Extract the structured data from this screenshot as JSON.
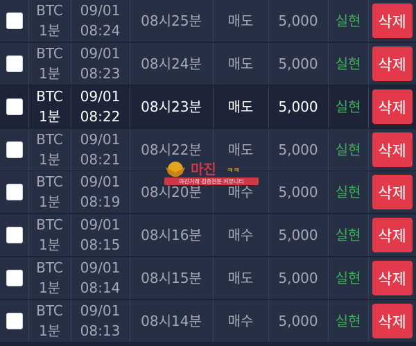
{
  "rows": [
    {
      "symbol": "BTC",
      "interval": "1분",
      "date": "09/01",
      "time": "08:24",
      "slot": "08시25분",
      "side": "매도",
      "amount": "5,000",
      "status": "실현",
      "delete_label": "삭제"
    },
    {
      "symbol": "BTC",
      "interval": "1분",
      "date": "09/01",
      "time": "08:23",
      "slot": "08시24분",
      "side": "매도",
      "amount": "5,000",
      "status": "실현",
      "delete_label": "삭제"
    },
    {
      "symbol": "BTC",
      "interval": "1분",
      "date": "09/01",
      "time": "08:22",
      "slot": "08시23분",
      "side": "매도",
      "amount": "5,000",
      "status": "실현",
      "delete_label": "삭제"
    },
    {
      "symbol": "BTC",
      "interval": "1분",
      "date": "09/01",
      "time": "08:21",
      "slot": "08시22분",
      "side": "매도",
      "amount": "5,000",
      "status": "실현",
      "delete_label": "삭제"
    },
    {
      "symbol": "BTC",
      "interval": "1분",
      "date": "09/01",
      "time": "08:19",
      "slot": "08시20분",
      "side": "매수",
      "amount": "5,000",
      "status": "실현",
      "delete_label": "삭제"
    },
    {
      "symbol": "BTC",
      "interval": "1분",
      "date": "09/01",
      "time": "08:15",
      "slot": "08시16분",
      "side": "매수",
      "amount": "5,000",
      "status": "실현",
      "delete_label": "삭제"
    },
    {
      "symbol": "BTC",
      "interval": "1분",
      "date": "09/01",
      "time": "08:14",
      "slot": "08시15분",
      "side": "매도",
      "amount": "5,000",
      "status": "실현",
      "delete_label": "삭제"
    },
    {
      "symbol": "BTC",
      "interval": "1분",
      "date": "09/01",
      "time": "08:13",
      "slot": "08시14분",
      "side": "매수",
      "amount": "5,000",
      "status": "실현",
      "delete_label": "삭제"
    }
  ],
  "highlighted_row": 2,
  "watermark": {
    "brand": "마진",
    "tagline": "마진거래 검증전문 커뮤니티"
  },
  "colors": {
    "background": "#1b2236",
    "row": "#272f45",
    "status_green": "#3fae5a",
    "delete_red": "#e23a4a"
  }
}
